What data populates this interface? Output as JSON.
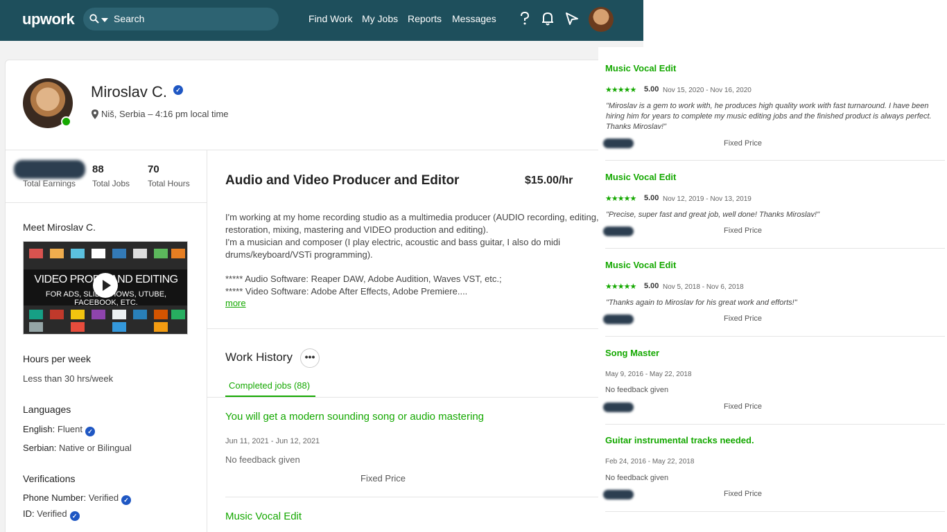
{
  "header": {
    "logo": "upwork",
    "search_placeholder": "Search",
    "nav": [
      "Find Work",
      "My Jobs",
      "Reports",
      "Messages"
    ]
  },
  "profile": {
    "name": "Miroslav C.",
    "location": "Niš, Serbia – 4:16 pm local time",
    "stats": {
      "jobs_value": "88",
      "jobs_label": "Total Jobs",
      "hours_value": "70",
      "hours_label": "Total Hours",
      "earnings_label": "Total Earnings"
    },
    "meet_title": "Meet Miroslav C.",
    "video": {
      "line1": "VIDEO PRODU        AND EDITING",
      "line2": "FOR ADS, SLIDESHOWS,  UTUBE, FACEBOOK, ETC."
    },
    "hours": {
      "title": "Hours per week",
      "value": "Less than 30 hrs/week"
    },
    "languages": {
      "title": "Languages",
      "items": [
        {
          "lang": "English:",
          "level": "Fluent"
        },
        {
          "lang": "Serbian:",
          "level": "Native or Bilingual"
        }
      ]
    },
    "verifications": {
      "title": "Verifications",
      "items": [
        {
          "label": "Phone Number:",
          "value": "Verified"
        },
        {
          "label": "ID:",
          "value": "Verified"
        }
      ]
    }
  },
  "main": {
    "title": "Audio and Video Producer and Editor",
    "rate": "$15.00/hr",
    "description": [
      "I'm working at my home recording studio as a multimedia producer (AUDIO recording, editing,",
      "restoration, mixing, mastering and VIDEO production and editing).",
      "I'm a musician and composer (I play electric, acoustic and bass guitar, I also do midi",
      "drums/keyboard/VSTi programming).",
      "***** Audio Software: Reaper DAW, Adobe Audition, Waves VST, etc.;",
      "***** Video Software: Adobe After Effects, Adobe Premiere...."
    ],
    "more_link": "more",
    "work_history": {
      "title": "Work History",
      "menu": "•••",
      "tab": "Completed jobs (88)",
      "jobs": [
        {
          "title": "You will get a modern sounding song or audio mastering",
          "dates": "Jun 11, 2021 - Jun 12, 2021",
          "feedback": "No feedback given",
          "type": "Fixed Price"
        },
        {
          "title": "Music Vocal Edit"
        }
      ]
    }
  },
  "overlay": {
    "items": [
      {
        "title": "Music Vocal Edit",
        "stars": "★★★★★",
        "score": "5.00",
        "dates": "Nov 15, 2020 - Nov 16, 2020",
        "quote": "\"Miroslav is a gem to work with, he produces high quality work with fast turnaround. I have been hiring him for years to complete my music editing jobs and the finished product is always perfect. Thanks Miroslav!\"",
        "type": "Fixed Price"
      },
      {
        "title": "Music Vocal Edit",
        "stars": "★★★★★",
        "score": "5.00",
        "dates": "Nov 12, 2019 - Nov 13, 2019",
        "quote": "\"Precise, super fast and great job, well done! Thanks Miroslav!\"",
        "type": "Fixed Price"
      },
      {
        "title": "Music Vocal Edit",
        "stars": "★★★★★",
        "score": "5.00",
        "dates": "Nov 5, 2018 - Nov 6, 2018",
        "quote": "\"Thanks again to Miroslav for his great work and efforts!\"",
        "type": "Fixed Price"
      },
      {
        "title": "Song Master",
        "dates": "May 9, 2016 - May 22, 2018",
        "feedback": "No feedback given",
        "type": "Fixed Price"
      },
      {
        "title": "Guitar instrumental tracks needed.",
        "dates": "Feb 24, 2016 - May 22, 2018",
        "feedback": "No feedback given",
        "type": "Fixed Price"
      }
    ]
  },
  "colors": {
    "header_bg": "#1e4f5c",
    "accent": "#14a800",
    "verified": "#1f57c3"
  }
}
